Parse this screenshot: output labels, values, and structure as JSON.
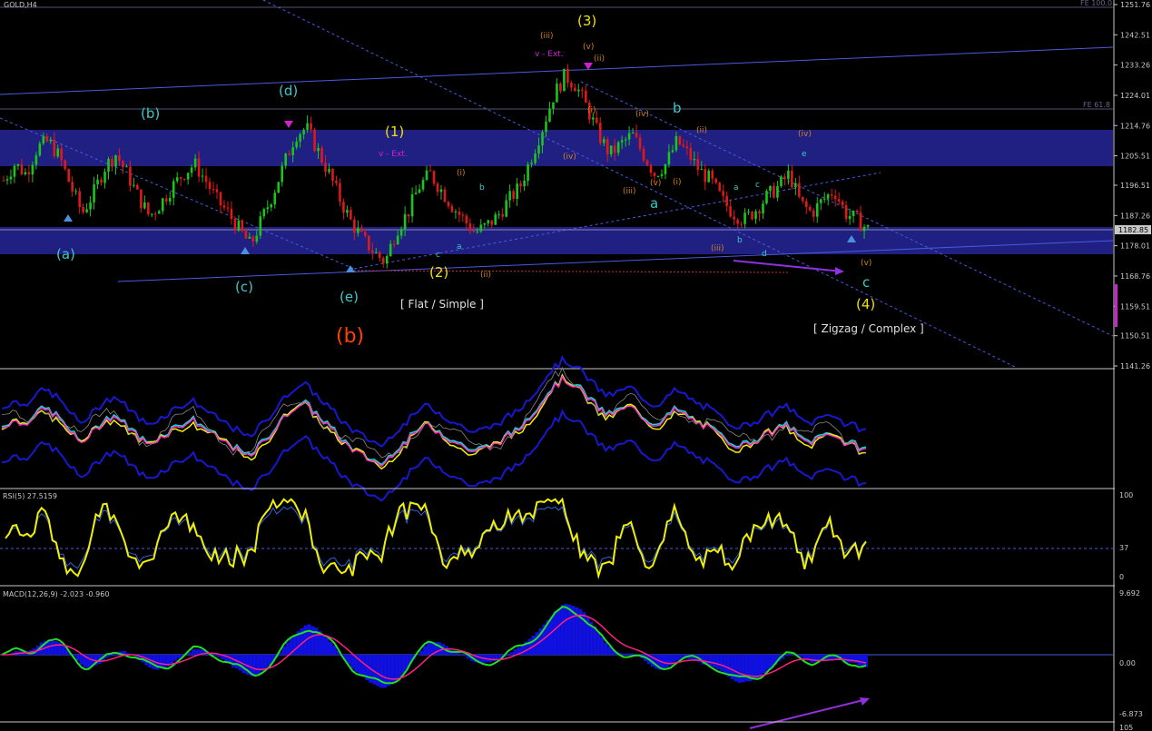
{
  "window": {
    "title": "GOLD,H4"
  },
  "colors": {
    "background": "#000000",
    "grid": "#4a4a6a",
    "bull": "#19c619",
    "bear": "#e01818",
    "zone": "#202083",
    "channel": "#4a5ae0",
    "label_cyan": "#3ec8c8",
    "label_yellow": "#f0e000",
    "label_orange": "#d08020",
    "label_magenta": "#d020d0",
    "label_red": "#ff4000",
    "rsi_line": "#f0f000",
    "macd_hist": "#1010e0",
    "macd_line": "#20e020",
    "macd_signal": "#ff2080"
  },
  "main_pane": {
    "fib_top": "FE 100.0",
    "fib_mid": "FE 61.8",
    "price_axis": [
      "1251.76",
      "1242.51",
      "1233.26",
      "1224.01",
      "1214.76",
      "1205.51",
      "1196.51",
      "1187.26",
      "1178.01",
      "1168.76",
      "1159.51",
      "1150.51",
      "1141.26"
    ],
    "current_price": "1182.85"
  },
  "wave_labels": {
    "a_big": "(a)",
    "b_big": "(b)",
    "c_big": "(c)",
    "d_big": "(d)",
    "e_big": "(e)",
    "b_red": "(b)",
    "one": "(1)",
    "two": "(2)",
    "three": "(3)",
    "four": "(4)",
    "c_cyan": "c",
    "a_cyan": "a",
    "b_cyan": "b",
    "v_ext1": "v - Ext.",
    "v_ext2": "v - Ext.",
    "iii_o": "(iii)",
    "v_o": "(v)",
    "ii_o": "(ii)",
    "i_o": "(i)",
    "iv_o": "(iv)",
    "i_o2": "(i)",
    "iii_o2": "(iii)",
    "iv_o2": "(iv)",
    "v_o2": "(v)",
    "ii_o2": "(ii)",
    "i_o3": "(i)",
    "ii_o3": "(ii)",
    "iii_o3": "(iii)",
    "iv_o3": "(iv)",
    "v_o3": "(v)",
    "e_small": "e",
    "d_small": "d",
    "c_small": "c",
    "b_small": "b",
    "a_small": "a",
    "c_small2": "c",
    "b_small2": "b",
    "a_small2": "a"
  },
  "notes": {
    "flat": "[ Flat / Simple ]",
    "zigzag": "[ Zigzag / Complex ]"
  },
  "rsi_pane": {
    "title": "RSI(5) 27.5159",
    "levels": [
      "100",
      "37",
      "0"
    ]
  },
  "macd_pane": {
    "title": "MACD(12,26,9) -2.023 -0.960",
    "levels": [
      "9.692",
      "0.00",
      "-6.873"
    ]
  },
  "bottom_pane": {
    "level": "105"
  },
  "chart_data": {
    "type": "candlestick",
    "symbol": "GOLD",
    "timeframe": "H4",
    "ylim": [
      1141.26,
      1251.76
    ],
    "close_path": [
      1198,
      1203,
      1200,
      1208,
      1210,
      1205,
      1196,
      1188,
      1194,
      1202,
      1206,
      1200,
      1193,
      1187,
      1191,
      1196,
      1200,
      1203,
      1198,
      1192,
      1188,
      1183,
      1178,
      1186,
      1194,
      1203,
      1212,
      1214,
      1207,
      1200,
      1192,
      1185,
      1180,
      1176,
      1173,
      1183,
      1188,
      1196,
      1200,
      1195,
      1190,
      1186,
      1182,
      1184,
      1187,
      1192,
      1196,
      1205,
      1214,
      1224,
      1230,
      1227,
      1220,
      1212,
      1206,
      1209,
      1212,
      1206,
      1200,
      1203,
      1210,
      1206,
      1201,
      1198,
      1192,
      1188,
      1186,
      1189,
      1193,
      1196,
      1200,
      1191,
      1188,
      1192,
      1195,
      1188,
      1186,
      1183
    ]
  }
}
